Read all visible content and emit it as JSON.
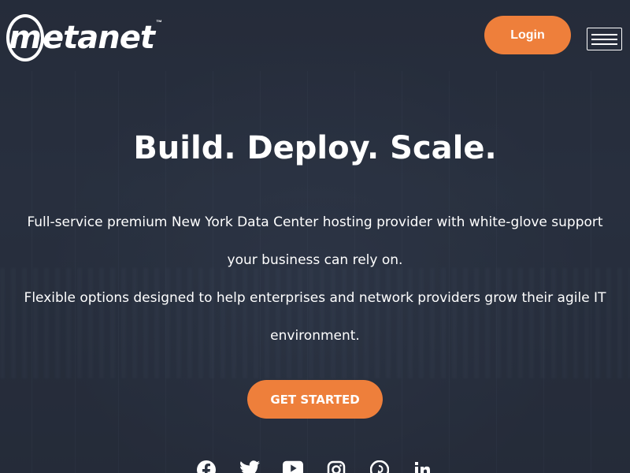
{
  "brand": {
    "name": "etanet",
    "mark": "m",
    "trademark": "™"
  },
  "header": {
    "login_label": "Login",
    "menu_icon": "hamburger-menu-icon"
  },
  "hero": {
    "headline": "Build. Deploy. Scale.",
    "description_1": "Full-service premium New York Data Center hosting provider with white-glove support your business can rely on.",
    "description_2": "Flexible options designed to help enterprises and network providers grow their agile IT environment.",
    "cta_label": "GET STARTED"
  },
  "social": [
    "facebook-icon",
    "twitter-icon",
    "youtube-icon",
    "instagram-icon",
    "pinterest-icon",
    "linkedin-icon"
  ],
  "colors": {
    "accent": "#ee7f3b",
    "background": "#2a3240",
    "text": "#ffffff"
  }
}
